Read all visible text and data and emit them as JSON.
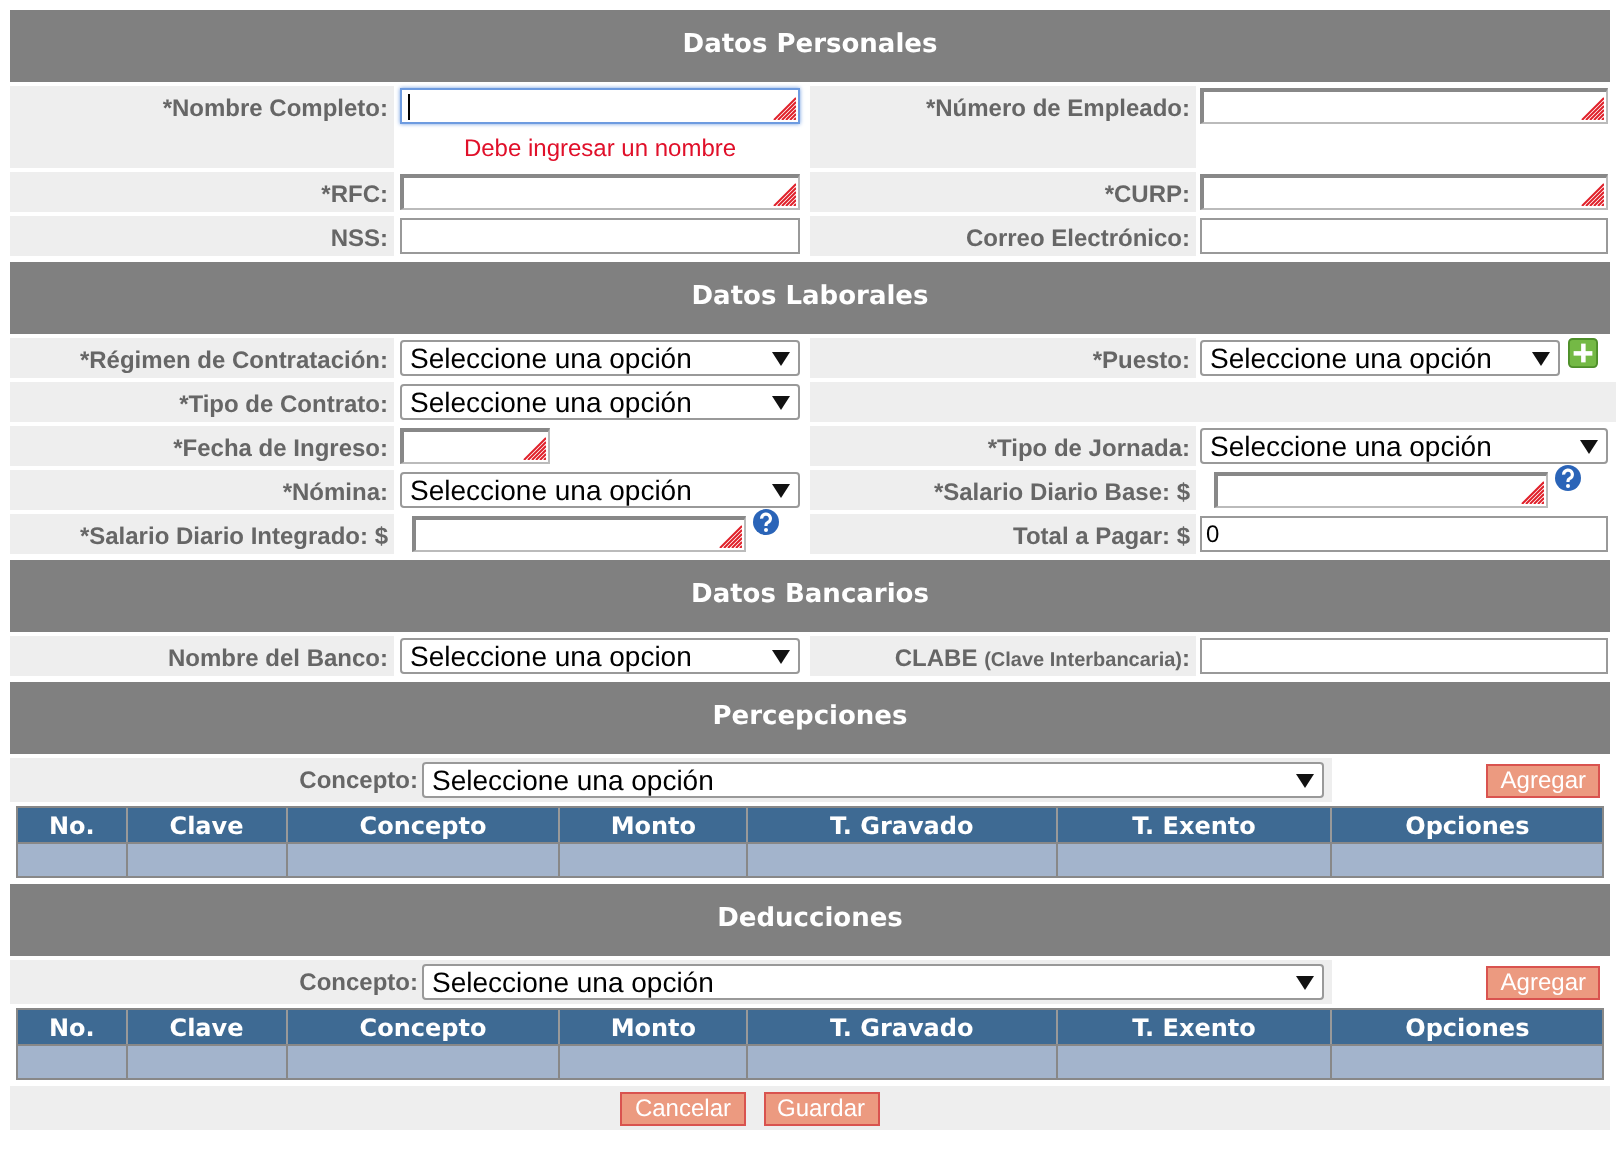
{
  "sections": [
    {
      "title": "Datos Personales",
      "kind": "form",
      "rows": [
        {
          "fields": [
            {
              "label": "*Nombre Completo:",
              "kind": "textarea",
              "required": true,
              "focused": true,
              "error": "Debe ingresar un nombre"
            },
            {
              "label": "*Número de Empleado:",
              "kind": "textarea",
              "required": true,
              "focused": false
            }
          ]
        },
        {
          "fields": [
            {
              "label": "*RFC:",
              "kind": "textarea",
              "required": true,
              "focused": false
            },
            {
              "label": "*CURP:",
              "kind": "textarea",
              "required": true,
              "focused": false
            }
          ]
        },
        {
          "fields": [
            {
              "label": "NSS:",
              "kind": "text"
            },
            {
              "label": "Correo Electrónico:",
              "kind": "text"
            }
          ]
        }
      ]
    },
    {
      "title": "Datos Laborales",
      "kind": "form",
      "rows": [
        {
          "fields": [
            {
              "label": "*Régimen de Contratación:",
              "kind": "select",
              "value": "Seleccione una opción"
            },
            {
              "label": "*Puesto:",
              "kind": "select",
              "value": "Seleccione una opción",
              "add": true
            }
          ]
        },
        {
          "fields": [
            {
              "label": "*Tipo de Contrato:",
              "kind": "select",
              "value": "Seleccione una opción"
            }
          ]
        },
        {
          "fields": [
            {
              "label": "*Fecha de Ingreso:",
              "kind": "date",
              "required": true,
              "focused": false
            },
            {
              "label": "*Tipo de Jornada:",
              "kind": "select",
              "value": "Seleccione una opción"
            }
          ]
        },
        {
          "fields": [
            {
              "label": "*Nómina:",
              "kind": "select",
              "value": "Seleccione una opción"
            },
            {
              "label": "*Salario Diario Base: $",
              "kind": "textarea",
              "required": true,
              "focused": false,
              "help": true
            }
          ]
        },
        {
          "fields": [
            {
              "label": "*Salario Diario Integrado: $",
              "kind": "textarea",
              "required": true,
              "focused": false,
              "help": true
            },
            {
              "label": "Total a Pagar: $",
              "kind": "text",
              "value": "0"
            }
          ]
        }
      ]
    },
    {
      "title": "Datos Bancarios",
      "kind": "form",
      "rows": [
        {
          "fields": [
            {
              "label": "Nombre del Banco:",
              "kind": "select",
              "value": "Seleccione una opcion"
            },
            {
              "label": "CLABE",
              "sublabel": "(Clave Interbancaria)",
              "suffix": ":",
              "kind": "text"
            }
          ]
        }
      ]
    },
    {
      "title": "Percepciones",
      "kind": "concepts",
      "concept": {
        "label": "Concepto:",
        "value": "Seleccione una opción",
        "button": "Agregar"
      },
      "columns": [
        "No.",
        "Clave",
        "Concepto",
        "Monto",
        "T. Gravado",
        "T. Exento",
        "Opciones"
      ]
    },
    {
      "title": "Deducciones",
      "kind": "concepts",
      "concept": {
        "label": "Concepto:",
        "value": "Seleccione una opción",
        "button": "Agregar"
      },
      "columns": [
        "No.",
        "Clave",
        "Concepto",
        "Monto",
        "T. Gravado",
        "T. Exento",
        "Opciones"
      ]
    }
  ],
  "buttons": [
    "Cancelar",
    "Guardar"
  ]
}
